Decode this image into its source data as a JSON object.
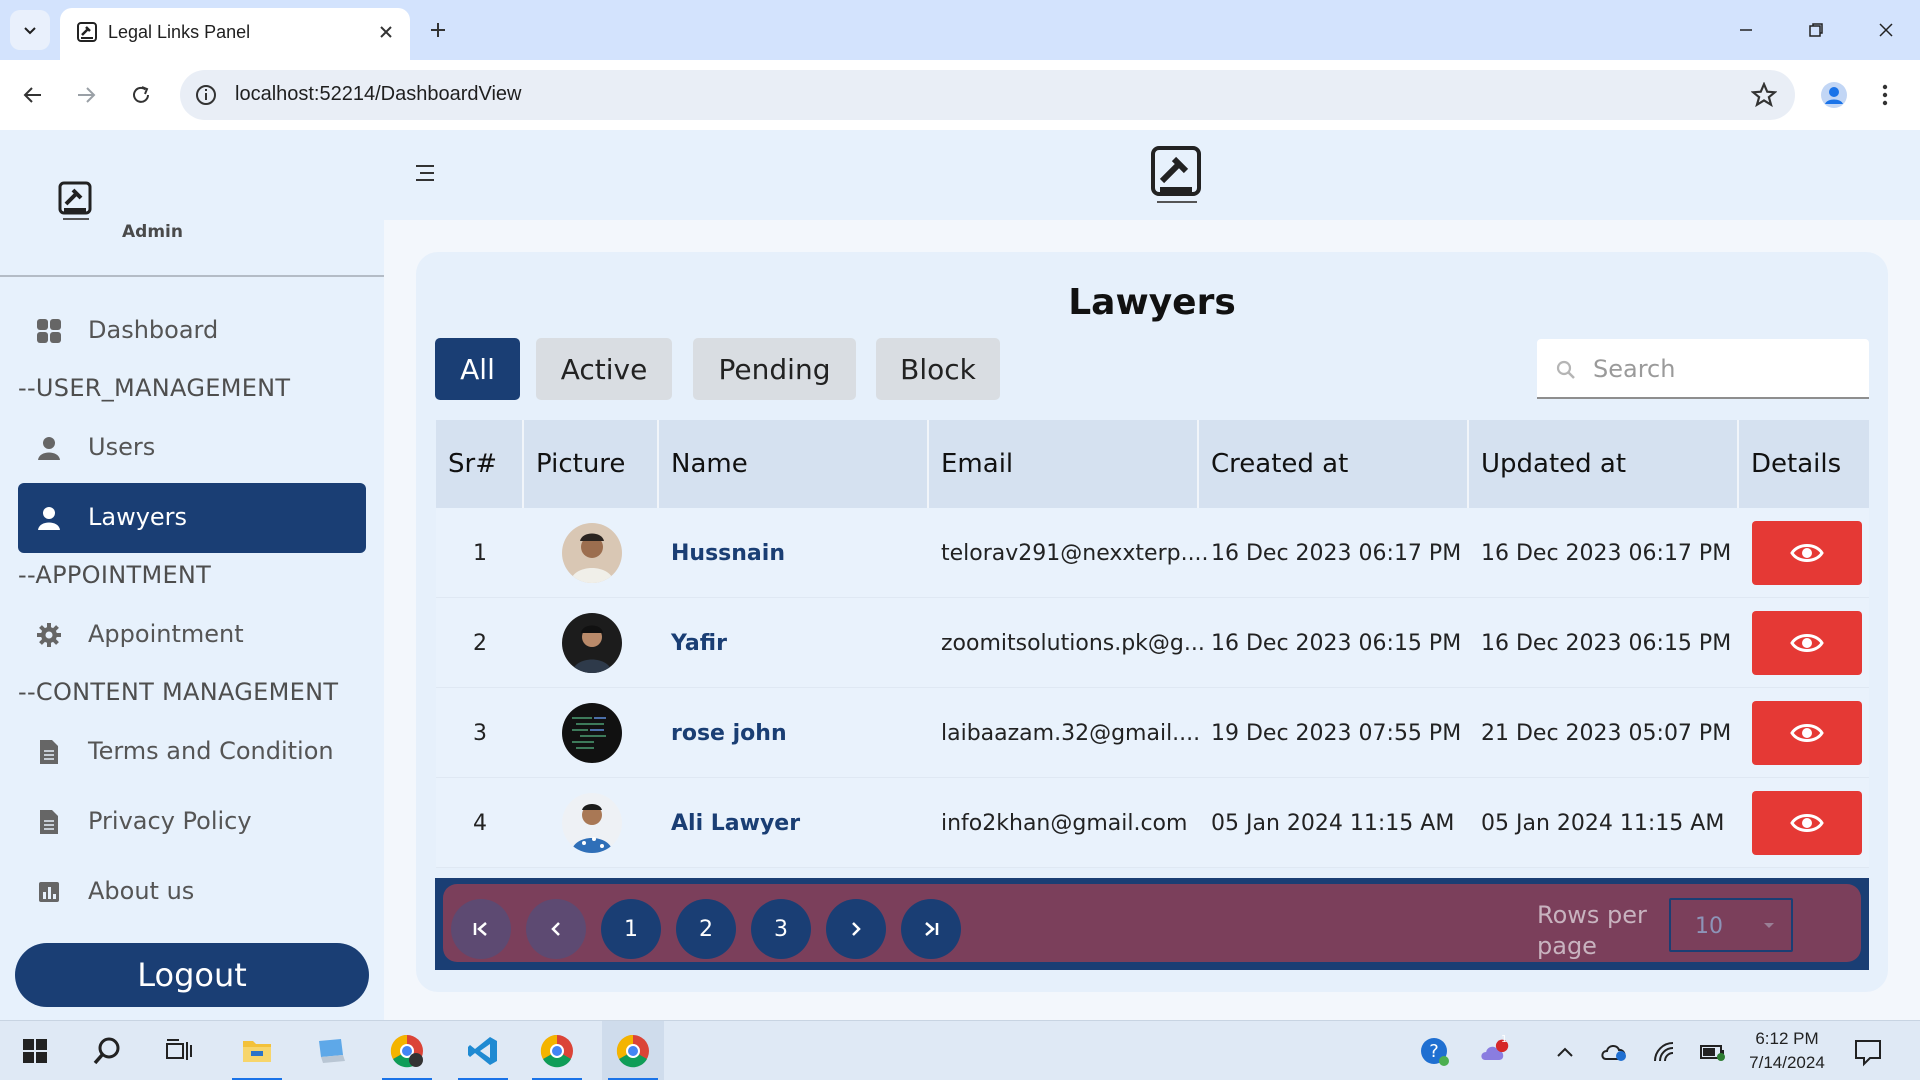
{
  "browser": {
    "tab_title": "Legal Links Panel",
    "url": "localhost:52214/DashboardView"
  },
  "sidebar": {
    "admin_label": "Admin",
    "items": [
      {
        "label": "Dashboard",
        "icon": "dashboard-icon"
      },
      {
        "label": "Users",
        "icon": "user-icon"
      },
      {
        "label": "Lawyers",
        "icon": "user-icon",
        "active": true
      },
      {
        "label": "Appointment",
        "icon": "gear-icon"
      },
      {
        "label": "Terms and Condition",
        "icon": "document-icon"
      },
      {
        "label": "Privacy Policy",
        "icon": "document-icon"
      },
      {
        "label": "About us",
        "icon": "chart-icon"
      }
    ],
    "sections": [
      "--USER_MANAGEMENT",
      "--APPOINTMENT",
      "--CONTENT MANAGEMENT"
    ],
    "logout_label": "Logout"
  },
  "main": {
    "title": "Lawyers",
    "filters": [
      "All",
      "Active",
      "Pending",
      "Block"
    ],
    "active_filter": "All",
    "search_placeholder": "Search",
    "columns": [
      "Sr#",
      "Picture",
      "Name",
      "Email",
      "Created at",
      "Updated at",
      "Details"
    ],
    "rows": [
      {
        "sr": "1",
        "name": "Hussnain",
        "email": "telorav291@nexxterp....",
        "created": "16 Dec 2023 06:17 PM",
        "updated": "16 Dec 2023 06:17 PM"
      },
      {
        "sr": "2",
        "name": "Yafir",
        "email": "zoomitsolutions.pk@g...",
        "created": "16 Dec 2023 06:15 PM",
        "updated": "16 Dec 2023 06:15 PM"
      },
      {
        "sr": "3",
        "name": "rose john",
        "email": "laibaazam.32@gmail....",
        "created": "19 Dec 2023 07:55 PM",
        "updated": "21 Dec 2023 05:07 PM"
      },
      {
        "sr": "4",
        "name": "Ali Lawyer",
        "email": "info2khan@gmail.com",
        "created": "05 Jan 2024 11:15 AM",
        "updated": "05 Jan 2024 11:15 AM"
      }
    ],
    "pagination": {
      "pages": [
        "1",
        "2",
        "3"
      ],
      "rows_per_page_label": "Rows per page",
      "rows_per_page_value": "10"
    }
  },
  "taskbar": {
    "time": "6:12 PM",
    "date": "7/14/2024",
    "notification_count": "1"
  },
  "colors": {
    "primary": "#1a3e74",
    "danger": "#e53935",
    "pager_inner": "#7b3f5b"
  }
}
